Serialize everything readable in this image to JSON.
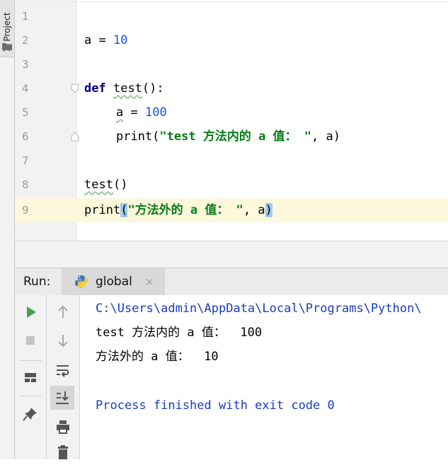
{
  "side_panel": {
    "tab_label": "1: Project"
  },
  "editor": {
    "lines": [
      {
        "number": "1",
        "text": ""
      },
      {
        "number": "2",
        "parts": [
          "a = ",
          "10"
        ]
      },
      {
        "number": "3",
        "text": ""
      },
      {
        "number": "4",
        "parts": [
          "def",
          " ",
          "test",
          "():"
        ]
      },
      {
        "number": "5",
        "parts": [
          "a",
          " = ",
          "100"
        ]
      },
      {
        "number": "6",
        "parts": [
          "print(",
          "\"test 方法内的 a 值： \"",
          ", a)"
        ]
      },
      {
        "number": "7",
        "text": ""
      },
      {
        "number": "8",
        "parts": [
          "test",
          "()"
        ]
      },
      {
        "number": "9",
        "parts": [
          "print",
          "(",
          "\"方法外的 a 值： \"",
          ", a",
          ")"
        ]
      }
    ],
    "current_line": "9"
  },
  "run_window": {
    "label": "Run:",
    "tab_label": "global",
    "close_glyph": "×",
    "console_lines": [
      "C:\\Users\\admin\\AppData\\Local\\Programs\\Python\\",
      "test 方法内的 a 值：  100",
      "方法外的 a 值：  10",
      "",
      "Process finished with exit code 0"
    ]
  },
  "colors": {
    "keyword": "#000080",
    "number": "#1750eb",
    "string": "#067d17",
    "current_line_bg": "#fdf7dc",
    "console_system": "#1a3dbb",
    "run_green": "#499c54"
  },
  "icons": {
    "side": [
      "folder-icon"
    ],
    "run_tab": [
      "python-icon",
      "close-icon"
    ],
    "toolbar_1": [
      "run-icon",
      "stop-icon",
      "layout-icon",
      "pin-icon"
    ],
    "toolbar_2": [
      "arrow-up-icon",
      "arrow-down-icon",
      "soft-wrap-icon",
      "scroll-to-end-icon",
      "print-icon",
      "trash-icon"
    ]
  }
}
